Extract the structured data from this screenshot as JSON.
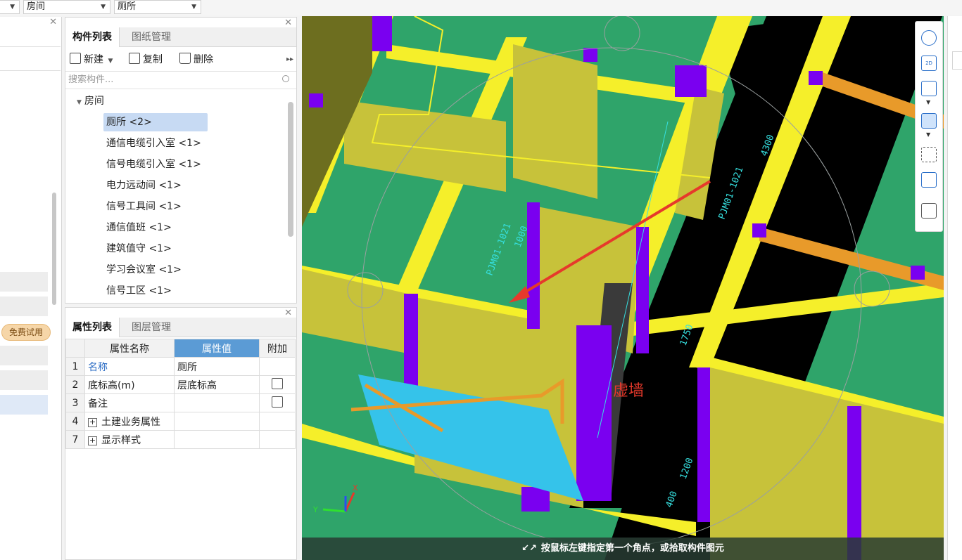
{
  "filters": {
    "type_value": "房间",
    "sub_value": "厕所"
  },
  "sidebar": {
    "trial_badge": "免费试用"
  },
  "component_panel": {
    "tabs": [
      "构件列表",
      "图纸管理"
    ],
    "toolbar": {
      "new": "新建",
      "copy": "复制",
      "delete": "删除"
    },
    "search_placeholder": "搜索构件...",
    "tree_root": "房间",
    "items": [
      "厕所 <2>",
      "通信电缆引入室 <1>",
      "信号电缆引入室 <1>",
      "电力远动间 <1>",
      "信号工具间 <1>",
      "通信值班 <1>",
      "建筑值守 <1>",
      "学习会议室 <1>",
      "信号工区 <1>"
    ]
  },
  "property_panel": {
    "tabs": [
      "属性列表",
      "图层管理"
    ],
    "columns": [
      "属性名称",
      "属性值",
      "附加"
    ],
    "rows": [
      {
        "num": "1",
        "name": "名称",
        "value": "厕所",
        "has_check": false,
        "expandable": false
      },
      {
        "num": "2",
        "name": "底标高(m)",
        "value": "层底标高",
        "has_check": true,
        "expandable": false
      },
      {
        "num": "3",
        "name": "备注",
        "value": "",
        "has_check": true,
        "expandable": false
      },
      {
        "num": "4",
        "name": "土建业务属性",
        "value": "",
        "has_check": false,
        "expandable": true
      },
      {
        "num": "7",
        "name": "显示样式",
        "value": "",
        "has_check": false,
        "expandable": true
      }
    ]
  },
  "viewport": {
    "annotation": "虚墙",
    "status": "按鼠标左键指定第一个角点，或拾取构件图元",
    "dim_labels": [
      "4300",
      "PJM01-1021",
      "1000",
      "1750",
      "1200",
      "400"
    ],
    "view_2d": "2D"
  },
  "colors": {
    "floor": "#2fa46a",
    "wall": "#c7c23a",
    "beam": "#f5ef2a",
    "column": "#7a00f0",
    "corridor": "#000000",
    "stairs": "#35c3ea",
    "arrow": "#e6392b",
    "selection": "#c7daf3"
  }
}
